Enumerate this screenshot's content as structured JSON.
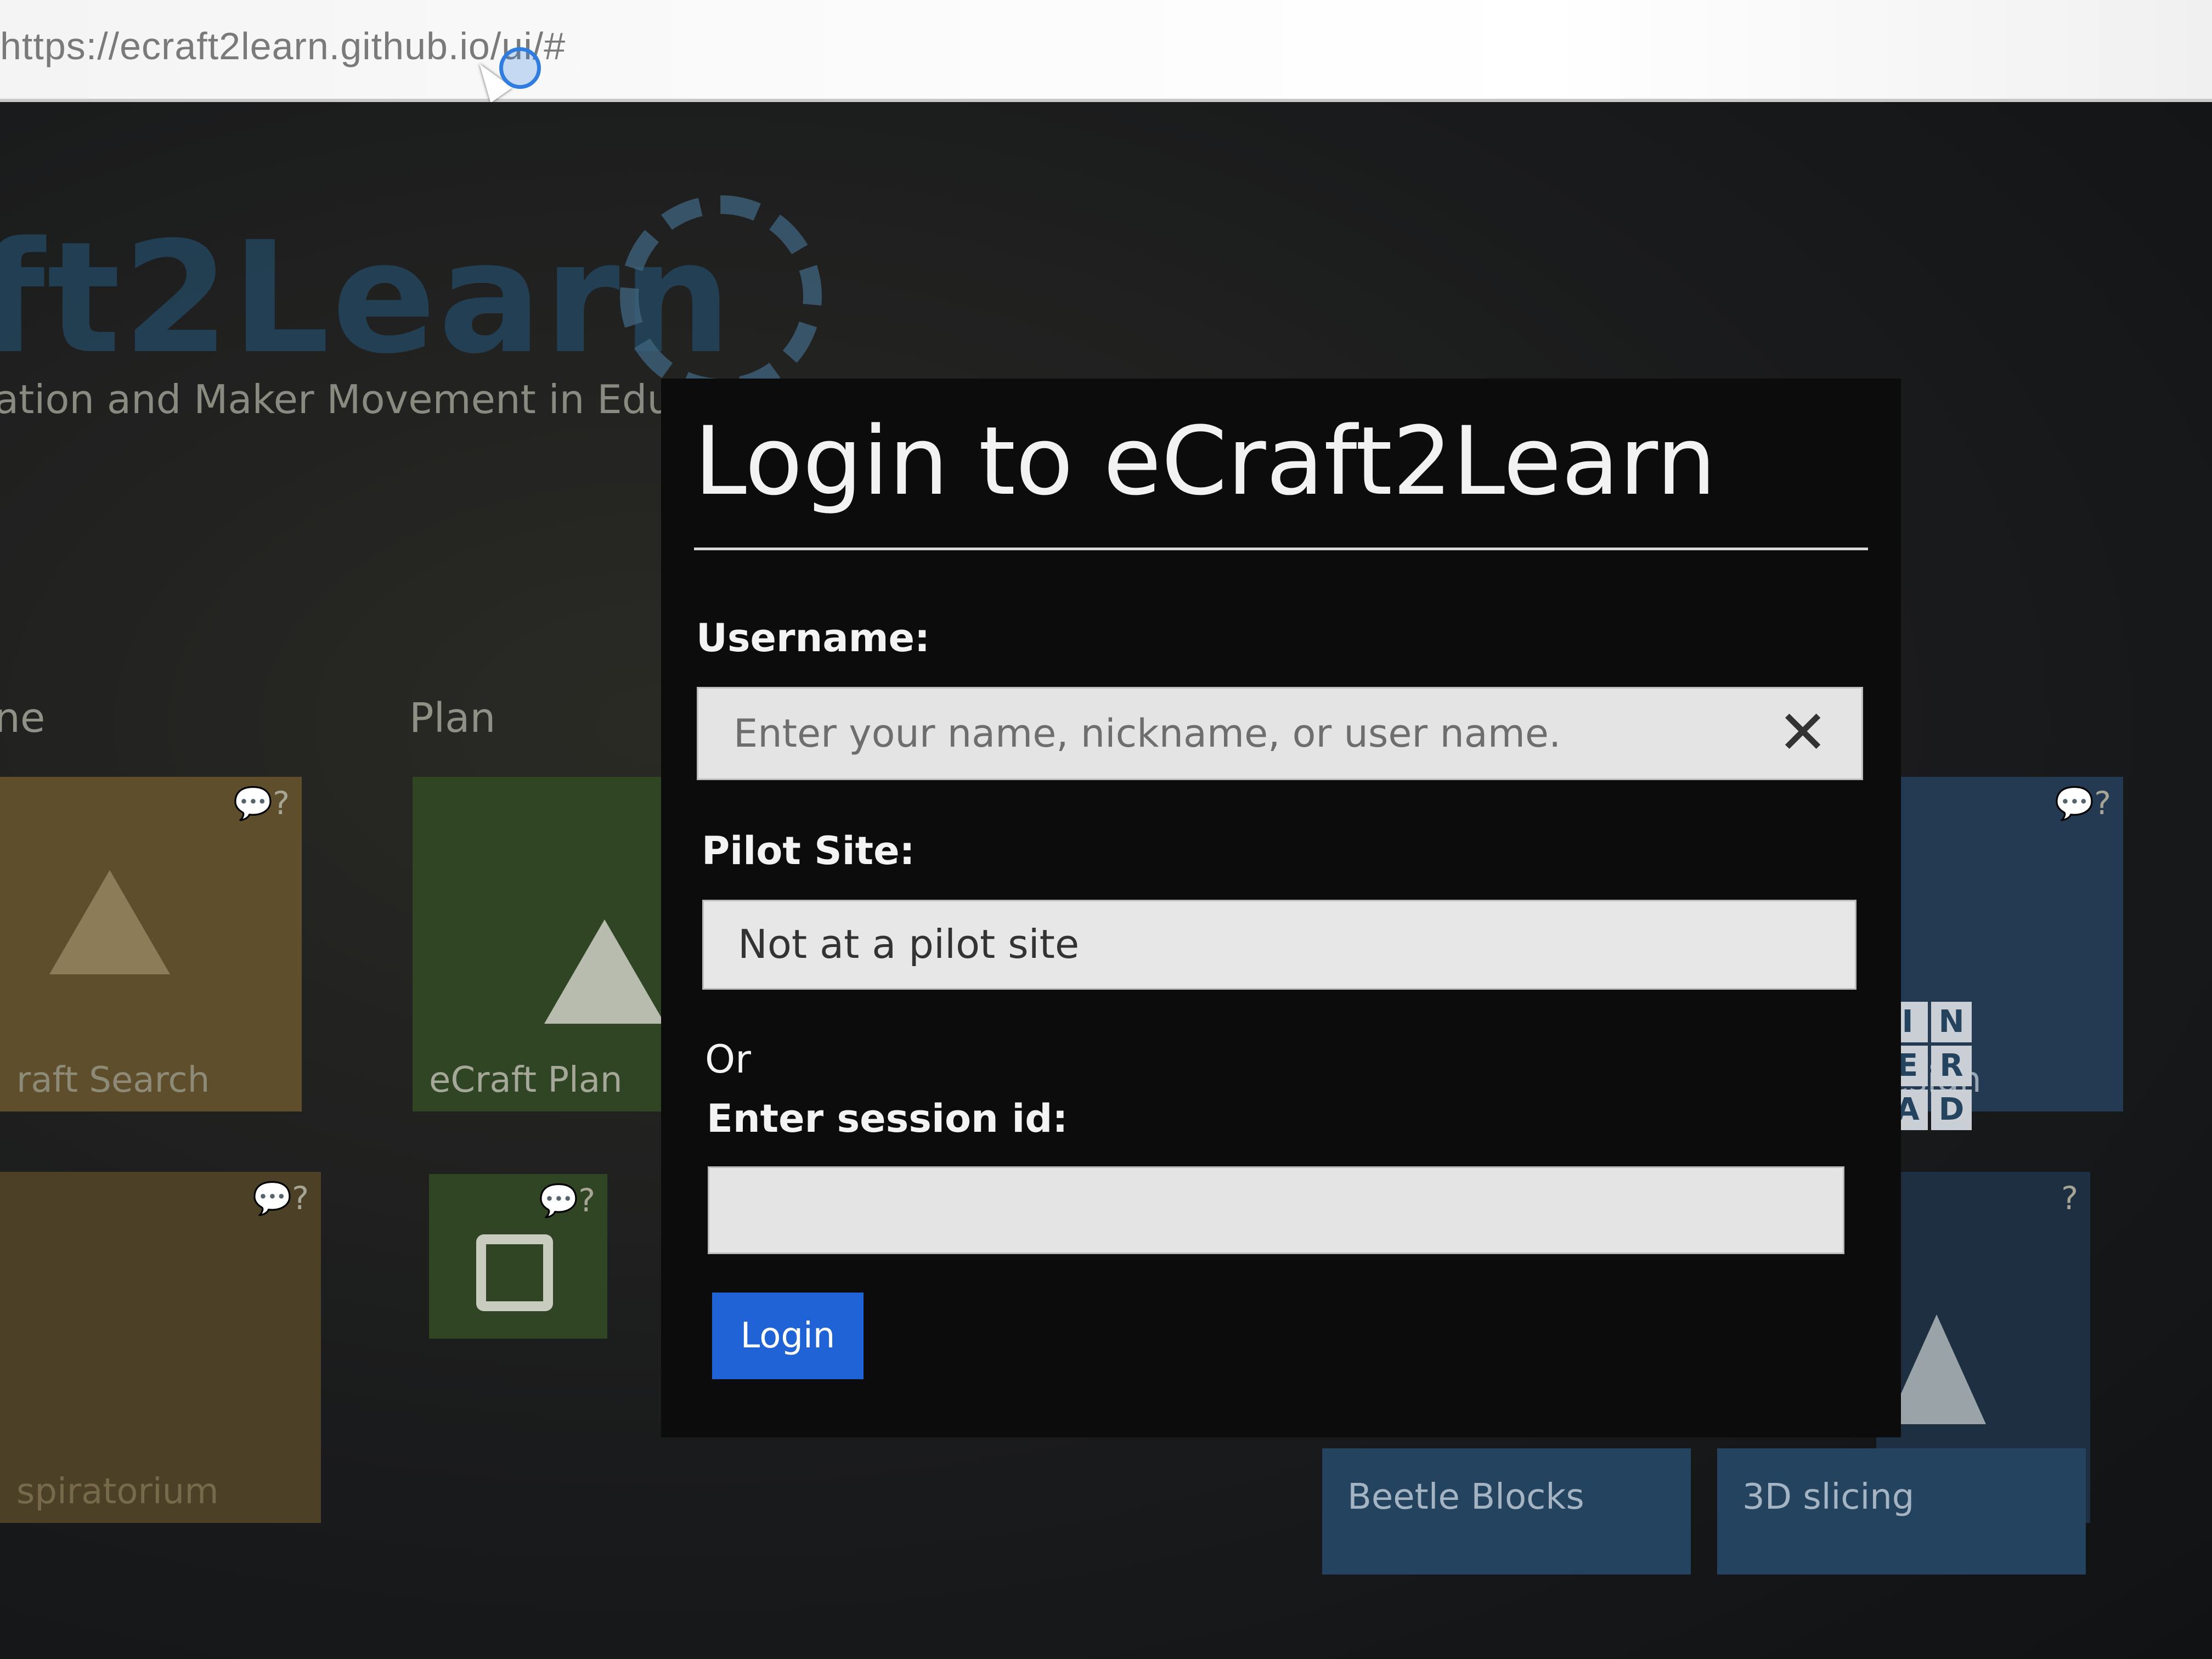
{
  "browser": {
    "url": "https://ecraft2learn.github.io/ui/#"
  },
  "background_page": {
    "logo_text": "ft2Learn",
    "tagline": "ation and Maker Movement in Educ",
    "column_headers": [
      "ne",
      "Plan"
    ],
    "tiles": [
      {
        "label": "raft Search",
        "color": "#8a6f3c",
        "icon": "google-drive-icon"
      },
      {
        "label": "eCraft Plan",
        "color": "#35572a",
        "icon": "google-drive-icon"
      },
      {
        "label": "spiratorium",
        "color": "#7a6439",
        "icon": "network-icon"
      },
      {
        "label": "",
        "color": "#35572a",
        "icon": "trello-icon"
      },
      {
        "label": "esign",
        "color": "#24435f",
        "icon": "tinkercad-icon"
      },
      {
        "label": "",
        "color": "#24435f",
        "icon": "pyramid-icon"
      }
    ],
    "tinkercad_letters": [
      "I",
      "N",
      "E",
      "R",
      "A",
      "D"
    ],
    "tool_tiles": [
      "Beetle Blocks",
      "3D slicing"
    ]
  },
  "login": {
    "title": "Login to eCraft2Learn",
    "username_label": "Username:",
    "username_placeholder": "Enter your name, nickname, or user name.",
    "clear_symbol": "✕",
    "pilot_site_label": "Pilot Site:",
    "pilot_site_value": "Not at a pilot site",
    "or_text": "Or",
    "session_label": "Enter session id:",
    "session_value": "",
    "login_button": "Login"
  }
}
